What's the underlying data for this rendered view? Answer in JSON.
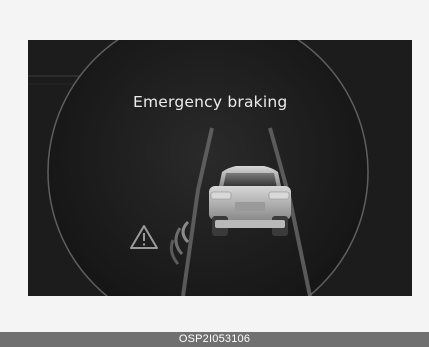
{
  "display": {
    "warning_message": "Emergency braking",
    "alert_icon": "warning-triangle-icon",
    "vehicle_icon": "car-rear-icon"
  },
  "caption": {
    "code": "OSP2I053106"
  },
  "colors": {
    "screen_background": "#1c1c1c",
    "message_text": "#ececec",
    "caption_bar": "#707070"
  }
}
